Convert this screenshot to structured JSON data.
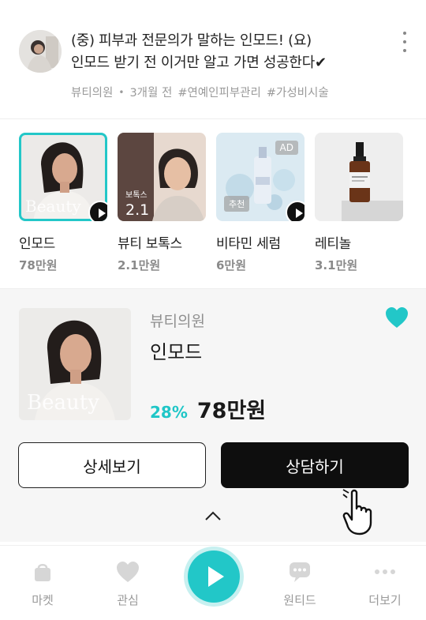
{
  "post": {
    "title_line1": "(중) 피부과 전문의가 말하는 인모드! (요)",
    "title_line2": "인모드 받기 전 이거만 알고 가면 성공한다✔",
    "author": "뷰티의원",
    "separator": "•",
    "time": "3개월 전",
    "tags": [
      "#연예인피부관리",
      "#가성비시술"
    ]
  },
  "carousel": [
    {
      "name": "인모드",
      "price": "78만원",
      "selected": true,
      "overlay": "Beauty",
      "play": true,
      "icon": "play-icon"
    },
    {
      "name": "뷰티 보톡스",
      "price": "2.1만원",
      "selected": false,
      "overlay_label": "보톡스",
      "overlay_price": "2.1",
      "play": false
    },
    {
      "name": "비타민 세럼",
      "price": "6만원",
      "selected": false,
      "badge": "AD",
      "rec_badge": "추천",
      "play": true,
      "icon": "play-icon"
    },
    {
      "name": "레티놀",
      "price": "3.1만원",
      "selected": false,
      "play": false
    }
  ],
  "detail": {
    "clinic": "뷰티의원",
    "product": "인모드",
    "discount": "28%",
    "price": "78만원",
    "overlay": "Beauty",
    "favorited": true,
    "detail_button": "상세보기",
    "consult_button": "상담하기"
  },
  "nav": {
    "items": [
      {
        "label": "마켓",
        "icon": "shopping-bag-icon"
      },
      {
        "label": "관심",
        "icon": "heart-icon"
      },
      {
        "label": "",
        "icon": "play-icon"
      },
      {
        "label": "원티드",
        "icon": "chat-icon"
      },
      {
        "label": "더보기",
        "icon": "more-icon"
      }
    ]
  },
  "colors": {
    "accent": "#22c7c8",
    "button_dark": "#0e0e0e",
    "muted": "#9a9a9a"
  }
}
